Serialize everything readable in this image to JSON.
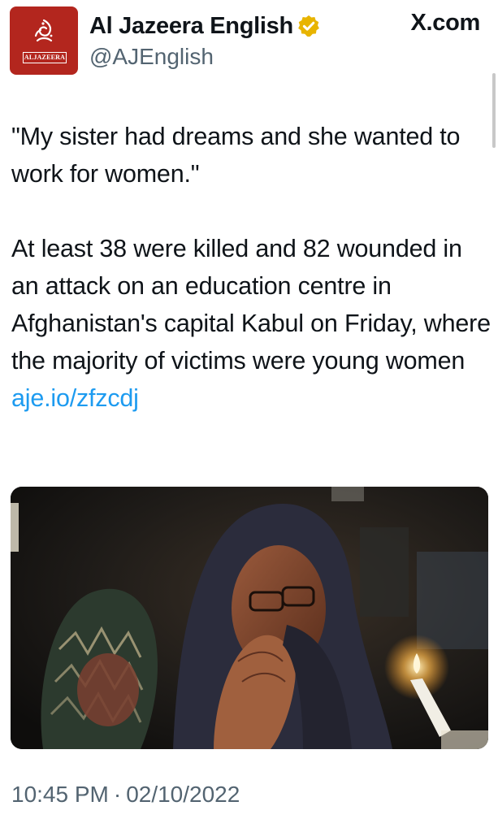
{
  "author": {
    "display_name": "Al Jazeera English",
    "handle": "@AJEnglish",
    "avatar_wordmark": "ALJAZEERA",
    "verified_badge": "gold-verified-badge-icon",
    "brand_color": "#b3261e",
    "verified_color": "#e8b400"
  },
  "site": {
    "label": "X.com"
  },
  "tweet": {
    "text_quote": "\"My sister had dreams and she wanted to work for women.\"",
    "text_body": "At least 38 were killed and 82 wounded in an attack on an education centre in Afghanistan's capital Kabul on Friday, where the majority of victims were young women ",
    "link": "aje.io/zfzcdj",
    "link_color": "#1d9bf0",
    "image_description_icon": "photo-icon"
  },
  "meta": {
    "time": "10:45 PM",
    "separator": "·",
    "date": "02/10/2022"
  }
}
